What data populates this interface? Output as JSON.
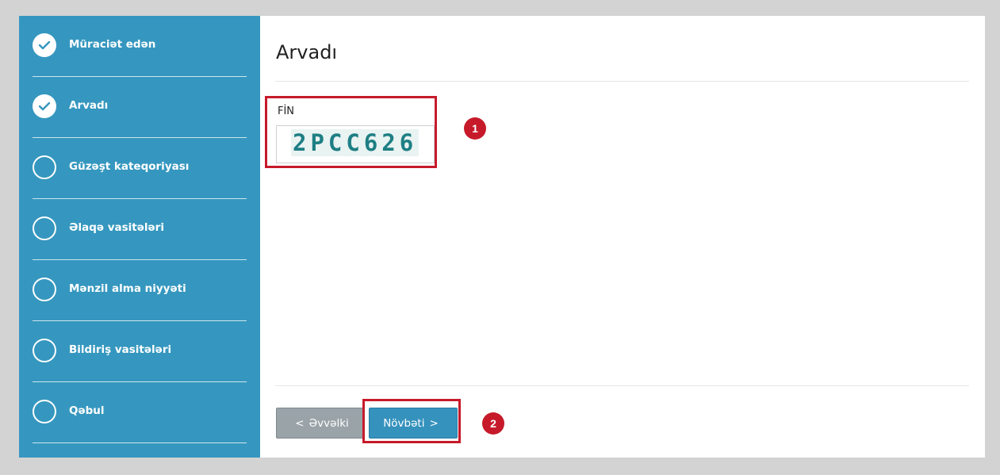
{
  "sidebar": {
    "steps": [
      {
        "label": "Müraciət edən",
        "status": "done"
      },
      {
        "label": "Arvadı",
        "status": "done"
      },
      {
        "label": "Güzəşt kateqoriyası",
        "status": "todo"
      },
      {
        "label": "Əlaqə vasitələri",
        "status": "todo"
      },
      {
        "label": "Mənzil alma niyyəti",
        "status": "todo"
      },
      {
        "label": "Bildiriş vasitələri",
        "status": "todo"
      },
      {
        "label": "Qəbul",
        "status": "todo"
      }
    ]
  },
  "main": {
    "title": "Arvadı",
    "fin_label": "FİN",
    "fin_value": "2PCC626"
  },
  "buttons": {
    "prev_arrow": "<",
    "prev_label": "Əvvəlki",
    "next_label": "Növbəti",
    "next_arrow": ">"
  },
  "annotations": {
    "badge_1": "1",
    "badge_2": "2",
    "highlight_color": "#c61a2a"
  },
  "colors": {
    "sidebar_bg": "#3597bf",
    "next_button": "#3592bd",
    "prev_button": "#9aa3a8"
  }
}
